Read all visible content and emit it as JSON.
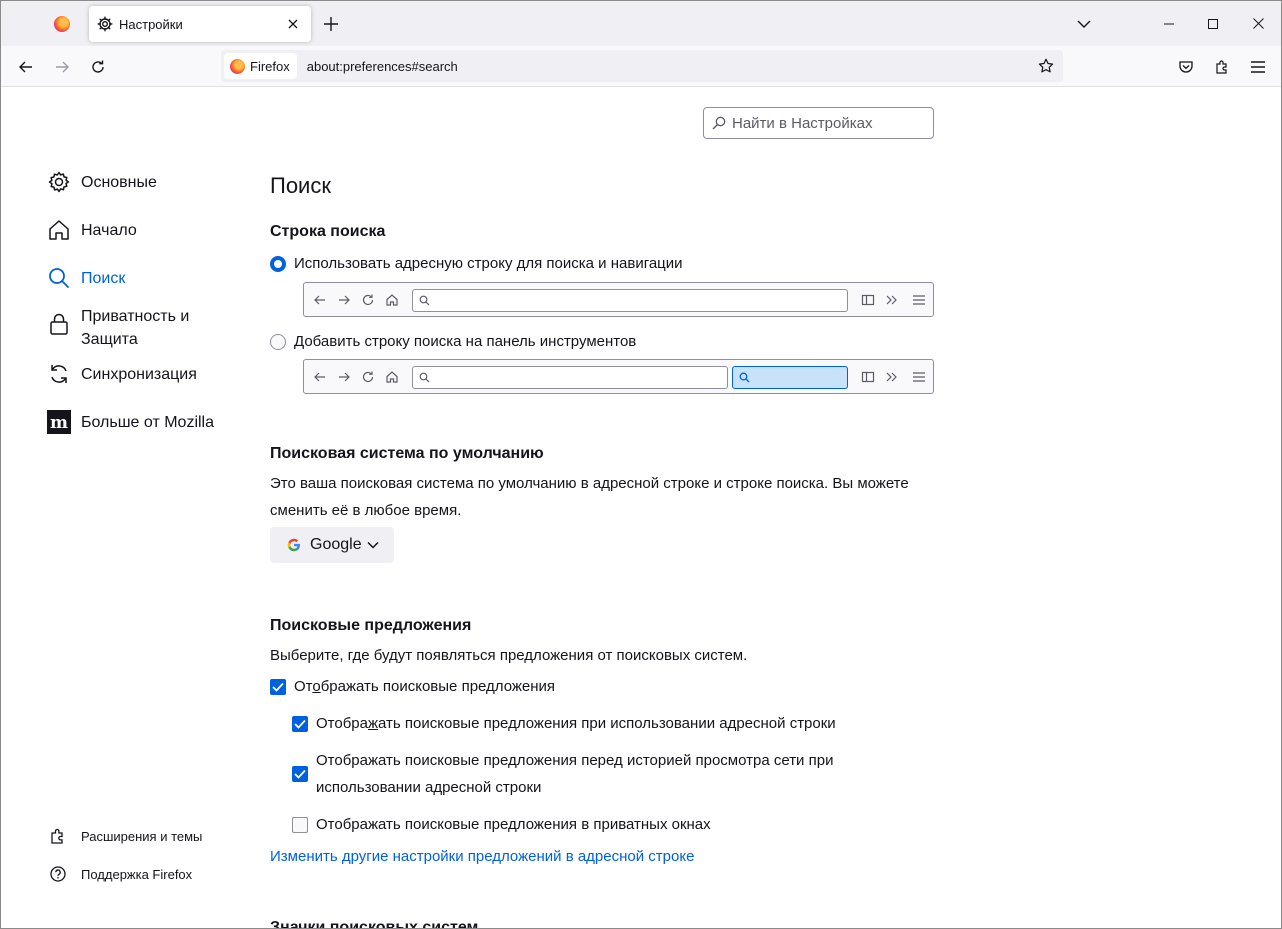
{
  "window": {
    "tabs": [
      {
        "label": "",
        "icon": "firefox-icon",
        "pinned": true
      },
      {
        "label": "Настройки",
        "icon": "gear-icon",
        "active": true
      }
    ],
    "controls": [
      "minimize",
      "maximize",
      "close"
    ]
  },
  "navbar": {
    "identity_label": "Firefox",
    "url": "about:preferences#search"
  },
  "prefs_search": {
    "placeholder": "Найти в Настройках"
  },
  "sidebar": {
    "categories": [
      {
        "label": "Основные",
        "icon": "gear-icon"
      },
      {
        "label": "Начало",
        "icon": "home-icon"
      },
      {
        "label": "Поиск",
        "icon": "search-icon",
        "active": true
      },
      {
        "label": "Приватность и Защита",
        "icon": "lock-icon"
      },
      {
        "label": "Синхронизация",
        "icon": "sync-icon"
      },
      {
        "label": "Больше от Mozilla",
        "icon": "mozilla-icon"
      }
    ],
    "footer": [
      {
        "label": "Расширения и темы",
        "icon": "puzzle-icon"
      },
      {
        "label": "Поддержка Firefox",
        "icon": "help-icon"
      }
    ]
  },
  "main": {
    "title": "Поиск",
    "searchbar_section": {
      "heading": "Строка поиска",
      "option_address": "Использовать адресную строку для поиска и навигации",
      "option_toolbar": "Добавить строку поиска на панель инструментов",
      "selected": "address"
    },
    "default_engine": {
      "heading": "Поисковая система по умолчанию",
      "description": "Это ваша поисковая система по умолчанию в адресной строке и строке поиска. Вы можете сменить её в любое время.",
      "engine": "Google"
    },
    "suggestions": {
      "heading": "Поисковые предложения",
      "description": "Выберите, где будут появляться предложения от поисковых систем.",
      "show_suggestions": {
        "pre": "От",
        "u": "о",
        "post": "бражать поисковые предложения",
        "checked": true
      },
      "in_address_bar": {
        "pre": "Отобра",
        "u": "ж",
        "post": "ать поисковые предложения при использовании адресной строки",
        "checked": true
      },
      "before_history": {
        "label": "Отображать поисковые предложения перед историей просмотра сети при использовании адресной строки",
        "checked": true
      },
      "in_private": {
        "label": "Отображать поисковые предложения в приватных окнах",
        "checked": false
      },
      "more_link": "Изменить другие настройки предложений в адресной строке"
    },
    "next_heading": "Значки поисковых систем"
  },
  "colors": {
    "accent": "#0061e0",
    "tabstrip": "#f0f0f4",
    "text": "#15141a"
  }
}
